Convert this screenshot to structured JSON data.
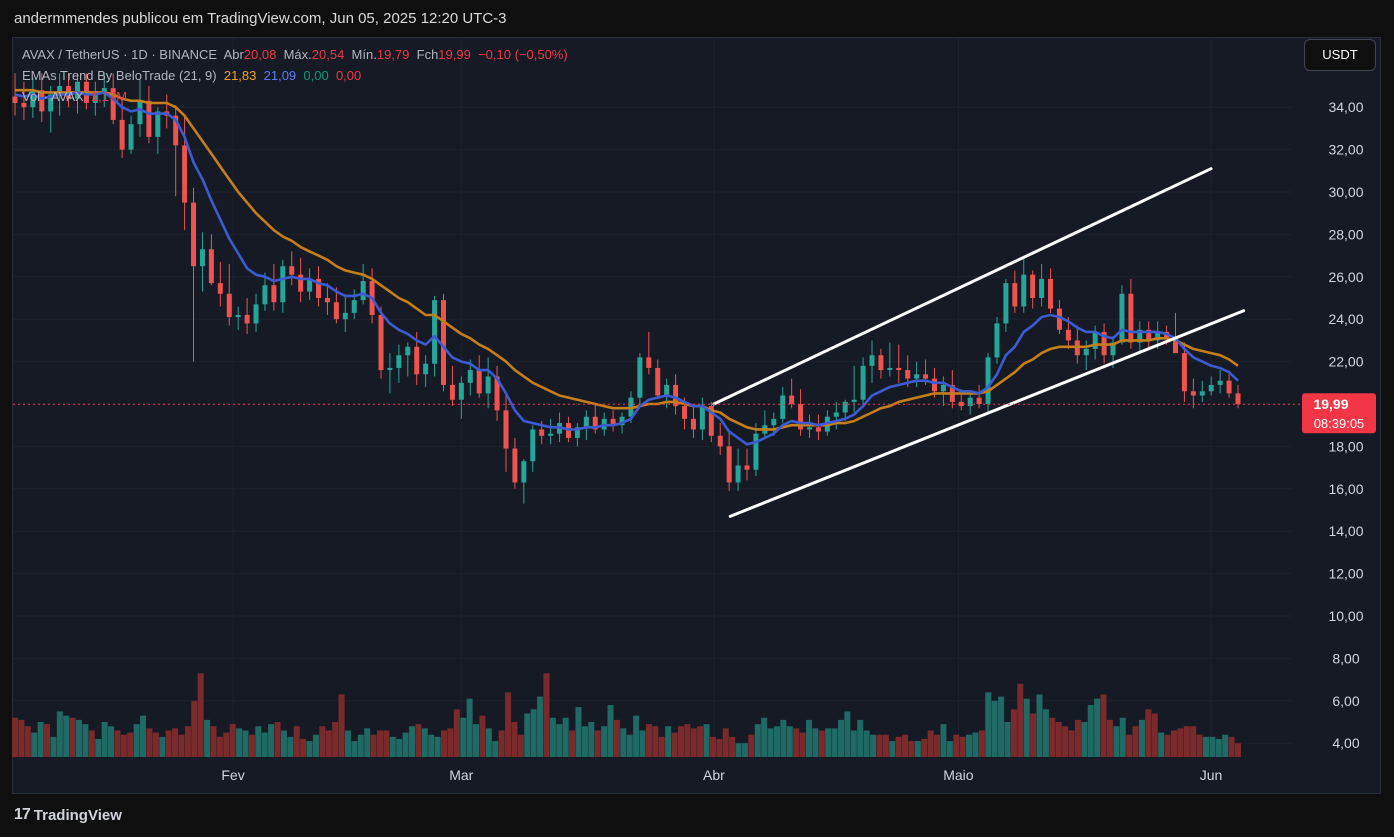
{
  "header": {
    "published_by": "andermmendes publicou em TradingView.com, Jun 05, 2025 12:20 UTC-3"
  },
  "legend": {
    "symbol": "AVAX / TetherUS · 1D · BINANCE",
    "open_label": "Abr",
    "open": "20,08",
    "high_label": "Máx.",
    "high": "20,54",
    "low_label": "Mín.",
    "low": "19,79",
    "close_label": "Fch",
    "close": "19,99",
    "change": "−0,10 (−0,50%)",
    "ema_name": "EMAs Trend By BeloTrade (21, 9)",
    "ema21": "21,83",
    "ema9": "21,09",
    "ema_v3": "0,00",
    "ema_v4": "0,00",
    "vol_name": "Vol · AVAX",
    "vol_value": "1,17M"
  },
  "currency_button": "USDT",
  "price_tag": {
    "price": "19,99",
    "countdown": "08:39:05"
  },
  "footer": {
    "brand": "TradingView",
    "logo": "tradingview-logo"
  },
  "colors": {
    "up": "#26a69a",
    "down": "#ef5350",
    "ema21": "#c57e1c",
    "ema9": "#3c5bd1",
    "vol_up": "#1f6a64",
    "vol_down": "#7b2a2c",
    "channel": "#ffffff",
    "last_price": "#f23645"
  },
  "chart_data": {
    "type": "candlestick",
    "y_axis_labels": [
      "34,00",
      "32,00",
      "30,00",
      "28,00",
      "26,00",
      "24,00",
      "22,00",
      "20,00",
      "18,00",
      "16,00",
      "14,00",
      "12,00",
      "10,00",
      "8,00",
      "6,00",
      "4,00"
    ],
    "y_axis_values": [
      34,
      32,
      30,
      28,
      26,
      24,
      22,
      20,
      18,
      16,
      14,
      12,
      10,
      8,
      6,
      4
    ],
    "ylim": [
      3.2,
      35.6
    ],
    "x_labels": [
      {
        "label": "Fev",
        "date": "2025-02-01"
      },
      {
        "label": "Mar",
        "date": "2025-03-01"
      },
      {
        "label": "Abr",
        "date": "2025-04-01"
      },
      {
        "label": "Maio",
        "date": "2025-05-01"
      },
      {
        "label": "Jun",
        "date": "2025-06-01"
      }
    ],
    "dates": [
      "2025-01-05",
      "2025-06-05"
    ],
    "ohlc": [
      [
        34.5,
        35.6,
        33.6,
        34.2
      ],
      [
        34.2,
        35.2,
        33.4,
        34.0
      ],
      [
        34.0,
        35.4,
        33.5,
        34.8
      ],
      [
        34.8,
        35.6,
        33.3,
        33.8
      ],
      [
        33.8,
        35.0,
        32.8,
        34.6
      ],
      [
        34.6,
        35.6,
        33.6,
        35.0
      ],
      [
        35.0,
        35.6,
        34.0,
        34.4
      ],
      [
        34.4,
        35.6,
        33.7,
        35.2
      ],
      [
        35.2,
        35.6,
        33.9,
        34.2
      ],
      [
        34.2,
        35.2,
        33.6,
        34.7
      ],
      [
        34.7,
        35.6,
        34.0,
        34.9
      ],
      [
        34.9,
        35.6,
        33.2,
        33.4
      ],
      [
        33.4,
        34.3,
        31.6,
        32.0
      ],
      [
        32.0,
        33.6,
        31.8,
        33.2
      ],
      [
        33.2,
        35.3,
        32.6,
        34.3
      ],
      [
        34.3,
        35.0,
        32.3,
        32.6
      ],
      [
        32.6,
        34.0,
        31.8,
        33.8
      ],
      [
        33.8,
        34.6,
        33.0,
        33.6
      ],
      [
        33.6,
        34.1,
        29.8,
        32.2
      ],
      [
        32.2,
        33.6,
        28.2,
        29.5
      ],
      [
        29.5,
        30.2,
        22.0,
        26.5
      ],
      [
        26.5,
        28.1,
        25.3,
        27.3
      ],
      [
        27.3,
        28.0,
        25.6,
        25.7
      ],
      [
        25.7,
        26.7,
        24.6,
        25.2
      ],
      [
        25.2,
        26.6,
        23.7,
        24.1
      ],
      [
        24.1,
        24.6,
        23.5,
        24.2
      ],
      [
        24.2,
        25.0,
        23.3,
        23.8
      ],
      [
        23.8,
        25.2,
        23.4,
        24.7
      ],
      [
        24.7,
        26.2,
        24.4,
        25.6
      ],
      [
        25.6,
        26.6,
        24.4,
        24.8
      ],
      [
        24.8,
        26.8,
        24.3,
        26.5
      ],
      [
        26.5,
        27.2,
        25.6,
        26.1
      ],
      [
        26.1,
        26.9,
        24.8,
        25.3
      ],
      [
        25.3,
        26.4,
        24.9,
        25.9
      ],
      [
        25.9,
        26.5,
        24.6,
        25.0
      ],
      [
        25.0,
        25.7,
        24.2,
        24.8
      ],
      [
        24.8,
        25.5,
        23.8,
        24.0
      ],
      [
        24.0,
        25.1,
        23.4,
        24.3
      ],
      [
        24.3,
        25.4,
        24.0,
        24.9
      ],
      [
        24.9,
        26.6,
        24.7,
        25.8
      ],
      [
        25.8,
        26.4,
        23.8,
        24.2
      ],
      [
        24.2,
        24.6,
        21.2,
        21.6
      ],
      [
        21.6,
        22.4,
        20.5,
        21.7
      ],
      [
        21.7,
        22.8,
        21.0,
        22.3
      ],
      [
        22.3,
        22.9,
        21.3,
        22.7
      ],
      [
        22.7,
        23.4,
        20.9,
        21.4
      ],
      [
        21.4,
        22.3,
        20.8,
        21.9
      ],
      [
        21.9,
        25.1,
        21.3,
        24.9
      ],
      [
        24.9,
        25.2,
        20.6,
        20.9
      ],
      [
        20.9,
        21.8,
        19.9,
        20.2
      ],
      [
        20.2,
        21.3,
        19.3,
        21.0
      ],
      [
        21.0,
        22.1,
        20.4,
        21.6
      ],
      [
        21.6,
        22.3,
        20.3,
        20.5
      ],
      [
        20.5,
        22.2,
        19.8,
        21.3
      ],
      [
        21.3,
        21.8,
        19.2,
        19.7
      ],
      [
        19.7,
        20.4,
        16.8,
        17.9
      ],
      [
        17.9,
        18.4,
        16.0,
        16.3
      ],
      [
        16.3,
        17.4,
        15.3,
        17.3
      ],
      [
        17.3,
        19.0,
        16.8,
        18.8
      ],
      [
        18.8,
        19.2,
        18.1,
        18.5
      ],
      [
        18.5,
        19.3,
        18.1,
        18.6
      ],
      [
        18.6,
        19.6,
        18.2,
        19.1
      ],
      [
        19.1,
        19.4,
        18.2,
        18.4
      ],
      [
        18.4,
        19.1,
        18.0,
        18.9
      ],
      [
        18.9,
        19.7,
        18.3,
        19.4
      ],
      [
        19.4,
        20.0,
        18.6,
        18.8
      ],
      [
        18.8,
        19.6,
        18.5,
        19.3
      ],
      [
        19.3,
        19.7,
        18.7,
        19.0
      ],
      [
        19.0,
        19.6,
        18.6,
        19.4
      ],
      [
        19.4,
        20.6,
        19.1,
        20.3
      ],
      [
        20.3,
        22.4,
        20.0,
        22.2
      ],
      [
        22.2,
        23.4,
        21.4,
        21.7
      ],
      [
        21.7,
        22.1,
        20.3,
        20.4
      ],
      [
        20.4,
        21.2,
        19.8,
        20.9
      ],
      [
        20.9,
        21.4,
        19.5,
        19.9
      ],
      [
        19.9,
        20.3,
        18.8,
        19.3
      ],
      [
        19.3,
        19.9,
        18.4,
        18.8
      ],
      [
        18.8,
        20.3,
        18.3,
        19.9
      ],
      [
        19.9,
        20.1,
        18.2,
        18.5
      ],
      [
        18.5,
        19.1,
        17.6,
        18.0
      ],
      [
        18.0,
        18.7,
        15.9,
        16.3
      ],
      [
        16.3,
        17.9,
        15.9,
        17.1
      ],
      [
        17.1,
        17.9,
        16.4,
        16.9
      ],
      [
        16.9,
        19.1,
        16.6,
        18.6
      ],
      [
        18.6,
        19.7,
        18.4,
        19.0
      ],
      [
        19.0,
        19.6,
        18.5,
        19.3
      ],
      [
        19.3,
        20.8,
        19.1,
        20.4
      ],
      [
        20.4,
        21.2,
        19.8,
        20.0
      ],
      [
        20.0,
        20.7,
        18.5,
        18.8
      ],
      [
        18.8,
        19.5,
        18.4,
        18.9
      ],
      [
        18.9,
        19.5,
        18.3,
        18.7
      ],
      [
        18.7,
        19.7,
        18.5,
        19.4
      ],
      [
        19.4,
        20.1,
        18.8,
        19.6
      ],
      [
        19.6,
        20.2,
        19.2,
        20.1
      ],
      [
        20.1,
        21.8,
        19.6,
        20.2
      ],
      [
        20.2,
        22.2,
        19.9,
        21.8
      ],
      [
        21.8,
        23.0,
        21.0,
        22.3
      ],
      [
        22.3,
        22.6,
        21.2,
        21.6
      ],
      [
        21.6,
        22.9,
        21.3,
        21.7
      ],
      [
        21.7,
        22.8,
        21.0,
        21.6
      ],
      [
        21.6,
        22.3,
        20.8,
        21.2
      ],
      [
        21.2,
        22.0,
        20.8,
        21.4
      ],
      [
        21.4,
        22.1,
        20.9,
        21.2
      ],
      [
        21.2,
        21.7,
        20.3,
        20.6
      ],
      [
        20.6,
        21.3,
        19.9,
        20.9
      ],
      [
        20.9,
        21.6,
        19.8,
        20.1
      ],
      [
        20.1,
        20.7,
        19.7,
        19.9
      ],
      [
        19.9,
        20.6,
        19.5,
        20.3
      ],
      [
        20.3,
        20.9,
        19.8,
        20.0
      ],
      [
        20.0,
        22.4,
        19.6,
        22.2
      ],
      [
        22.2,
        24.1,
        21.9,
        23.8
      ],
      [
        23.8,
        25.9,
        23.4,
        25.7
      ],
      [
        25.7,
        26.3,
        24.3,
        24.6
      ],
      [
        24.6,
        26.9,
        24.3,
        26.1
      ],
      [
        26.1,
        26.3,
        24.5,
        25.0
      ],
      [
        25.0,
        26.6,
        24.6,
        25.9
      ],
      [
        25.9,
        26.4,
        24.3,
        24.5
      ],
      [
        24.5,
        24.9,
        23.3,
        23.5
      ],
      [
        23.5,
        24.1,
        22.6,
        23.0
      ],
      [
        23.0,
        23.7,
        21.9,
        22.3
      ],
      [
        22.3,
        23.0,
        21.6,
        22.6
      ],
      [
        22.6,
        23.7,
        22.1,
        23.4
      ],
      [
        23.4,
        23.8,
        21.9,
        22.3
      ],
      [
        22.3,
        23.2,
        21.7,
        22.9
      ],
      [
        22.9,
        25.6,
        22.8,
        25.2
      ],
      [
        25.2,
        25.9,
        22.6,
        22.9
      ],
      [
        22.9,
        23.9,
        22.5,
        23.5
      ],
      [
        23.5,
        23.9,
        22.6,
        23.0
      ],
      [
        23.0,
        23.9,
        22.6,
        23.4
      ],
      [
        23.4,
        23.7,
        22.8,
        23.1
      ],
      [
        23.1,
        24.3,
        22.4,
        22.4
      ],
      [
        22.4,
        22.9,
        20.1,
        20.6
      ],
      [
        20.6,
        21.2,
        19.8,
        20.4
      ],
      [
        20.4,
        21.1,
        20.1,
        20.6
      ],
      [
        20.6,
        21.3,
        20.4,
        20.9
      ],
      [
        20.9,
        21.6,
        20.5,
        21.1
      ],
      [
        21.1,
        21.4,
        20.3,
        20.5
      ],
      [
        20.5,
        20.9,
        19.8,
        19.99
      ]
    ],
    "ema9": [
      34.6,
      34.5,
      34.6,
      34.4,
      34.5,
      34.6,
      34.6,
      34.7,
      34.6,
      34.6,
      34.7,
      34.4,
      34.0,
      33.8,
      33.9,
      33.7,
      33.7,
      33.7,
      33.4,
      32.6,
      31.4,
      30.6,
      29.6,
      28.7,
      27.8,
      27.1,
      26.4,
      26.1,
      26.0,
      25.8,
      25.9,
      26.0,
      25.9,
      25.9,
      25.7,
      25.6,
      25.3,
      25.1,
      25.1,
      25.2,
      25.0,
      24.3,
      23.8,
      23.5,
      23.3,
      23.0,
      22.8,
      23.2,
      22.7,
      22.2,
      22.0,
      21.9,
      21.6,
      21.6,
      21.2,
      20.5,
      19.7,
      19.2,
      19.1,
      19.0,
      18.9,
      18.9,
      18.8,
      18.8,
      18.9,
      18.9,
      19.0,
      19.0,
      19.1,
      19.3,
      19.9,
      20.2,
      20.3,
      20.4,
      20.3,
      20.1,
      19.9,
      19.9,
      19.6,
      19.3,
      18.7,
      18.4,
      18.1,
      18.2,
      18.4,
      18.6,
      19.0,
      19.2,
      19.1,
      19.1,
      19.0,
      19.1,
      19.2,
      19.3,
      19.5,
      19.9,
      20.4,
      20.6,
      20.8,
      20.9,
      21.0,
      21.1,
      21.1,
      21.0,
      21.0,
      20.8,
      20.6,
      20.6,
      20.5,
      20.8,
      21.4,
      22.3,
      22.7,
      23.4,
      23.7,
      24.1,
      24.2,
      24.1,
      23.9,
      23.6,
      23.4,
      23.4,
      23.2,
      23.1,
      23.5,
      23.4,
      23.4,
      23.4,
      23.4,
      23.3,
      23.1,
      22.6,
      22.2,
      22.0,
      21.8,
      21.7,
      21.5,
      21.1
    ],
    "ema21": [
      34.8,
      34.8,
      34.8,
      34.7,
      34.7,
      34.7,
      34.7,
      34.7,
      34.7,
      34.7,
      34.7,
      34.6,
      34.4,
      34.3,
      34.3,
      34.2,
      34.2,
      34.2,
      34.0,
      33.6,
      33.0,
      32.4,
      31.8,
      31.2,
      30.6,
      30.0,
      29.5,
      29.0,
      28.6,
      28.2,
      27.9,
      27.7,
      27.4,
      27.2,
      27.0,
      26.8,
      26.5,
      26.3,
      26.2,
      26.1,
      25.9,
      25.6,
      25.3,
      25.0,
      24.8,
      24.5,
      24.2,
      24.2,
      23.9,
      23.6,
      23.3,
      23.1,
      22.8,
      22.6,
      22.3,
      22.0,
      21.6,
      21.3,
      21.0,
      20.8,
      20.6,
      20.4,
      20.3,
      20.2,
      20.1,
      20.0,
      19.9,
      19.8,
      19.8,
      19.8,
      19.9,
      20.0,
      20.0,
      20.1,
      20.1,
      20.0,
      19.9,
      19.9,
      19.7,
      19.6,
      19.3,
      19.1,
      18.9,
      18.8,
      18.8,
      18.8,
      18.9,
      19.0,
      19.0,
      19.0,
      19.0,
      19.0,
      19.1,
      19.1,
      19.2,
      19.4,
      19.6,
      19.8,
      19.9,
      20.1,
      20.2,
      20.3,
      20.4,
      20.5,
      20.5,
      20.5,
      20.5,
      20.5,
      20.5,
      20.6,
      20.9,
      21.2,
      21.5,
      21.9,
      22.1,
      22.4,
      22.6,
      22.7,
      22.7,
      22.7,
      22.7,
      22.8,
      22.8,
      22.8,
      23.0,
      23.0,
      23.0,
      23.0,
      23.1,
      23.1,
      23.0,
      22.8,
      22.6,
      22.5,
      22.4,
      22.3,
      22.1,
      21.8
    ],
    "volume": [
      5.2,
      5.1,
      4.8,
      4.5,
      5.0,
      4.9,
      4.3,
      5.5,
      5.3,
      5.2,
      5.1,
      4.9,
      4.6,
      4.2,
      5.0,
      4.8,
      4.6,
      4.4,
      4.5,
      4.9,
      5.3,
      4.7,
      4.5,
      4.3,
      4.6,
      4.7,
      4.4,
      4.8,
      6.0,
      7.3,
      5.1,
      4.8,
      4.3,
      4.5,
      4.9,
      4.7,
      4.6,
      4.4,
      4.8,
      4.5,
      4.9,
      5.0,
      4.6,
      4.3,
      4.8,
      4.2,
      4.1,
      4.4,
      4.8,
      4.6,
      5.0,
      6.3,
      4.6,
      4.1,
      4.4,
      4.7,
      4.4,
      4.6,
      4.6,
      4.3,
      4.2,
      4.5,
      4.8,
      4.9,
      4.7,
      4.4,
      4.3,
      4.6,
      4.7,
      5.6,
      5.2,
      6.1,
      4.9,
      5.3,
      4.7,
      4.1,
      4.6,
      6.4,
      5.0,
      4.4,
      5.4,
      5.6,
      6.2,
      7.3,
      5.2,
      4.9,
      5.2,
      4.6,
      5.7,
      4.8,
      5.0,
      4.6,
      4.8,
      5.8,
      5.1,
      4.7,
      4.4,
      5.3,
      4.6,
      4.9,
      4.8,
      4.3,
      4.8,
      4.5,
      4.8,
      4.9,
      4.7,
      4.8,
      4.9,
      4.3,
      4.2,
      4.7,
      4.3,
      4.0,
      4.0,
      4.4,
      4.9,
      5.2,
      4.7,
      4.8,
      5.1,
      4.8,
      4.7,
      4.5,
      5.1,
      4.7,
      4.6,
      4.7,
      4.7,
      5.1,
      5.5,
      4.6,
      5.1,
      4.6,
      4.4,
      4.4,
      4.4,
      4.1,
      4.3,
      4.4,
      4.1,
      4.1,
      4.2,
      4.6,
      4.4,
      4.9,
      4.1,
      4.4,
      4.3,
      4.4,
      4.5,
      4.6,
      6.4,
      6.0,
      6.2,
      5.0,
      5.6,
      6.8,
      6.1,
      5.4,
      6.3,
      5.6,
      5.2,
      5.0,
      4.8,
      4.6,
      5.1,
      5.0,
      5.8,
      6.1,
      6.3,
      5.1,
      4.8,
      5.2,
      4.4,
      4.8,
      5.1,
      5.6,
      5.4,
      4.5,
      4.4,
      4.6,
      4.7,
      4.8,
      4.8,
      4.4,
      4.3,
      4.3,
      4.2,
      4.4,
      4.3,
      4.0
    ],
    "channel": {
      "upper": [
        {
          "date": "2025-04-01",
          "y": 20.0
        },
        {
          "date": "2025-06-01",
          "y": 31.1
        }
      ],
      "lower": [
        {
          "date": "2025-04-03",
          "y": 14.7
        },
        {
          "date": "2025-06-05",
          "y": 24.4
        }
      ]
    },
    "last_price": 19.99
  }
}
